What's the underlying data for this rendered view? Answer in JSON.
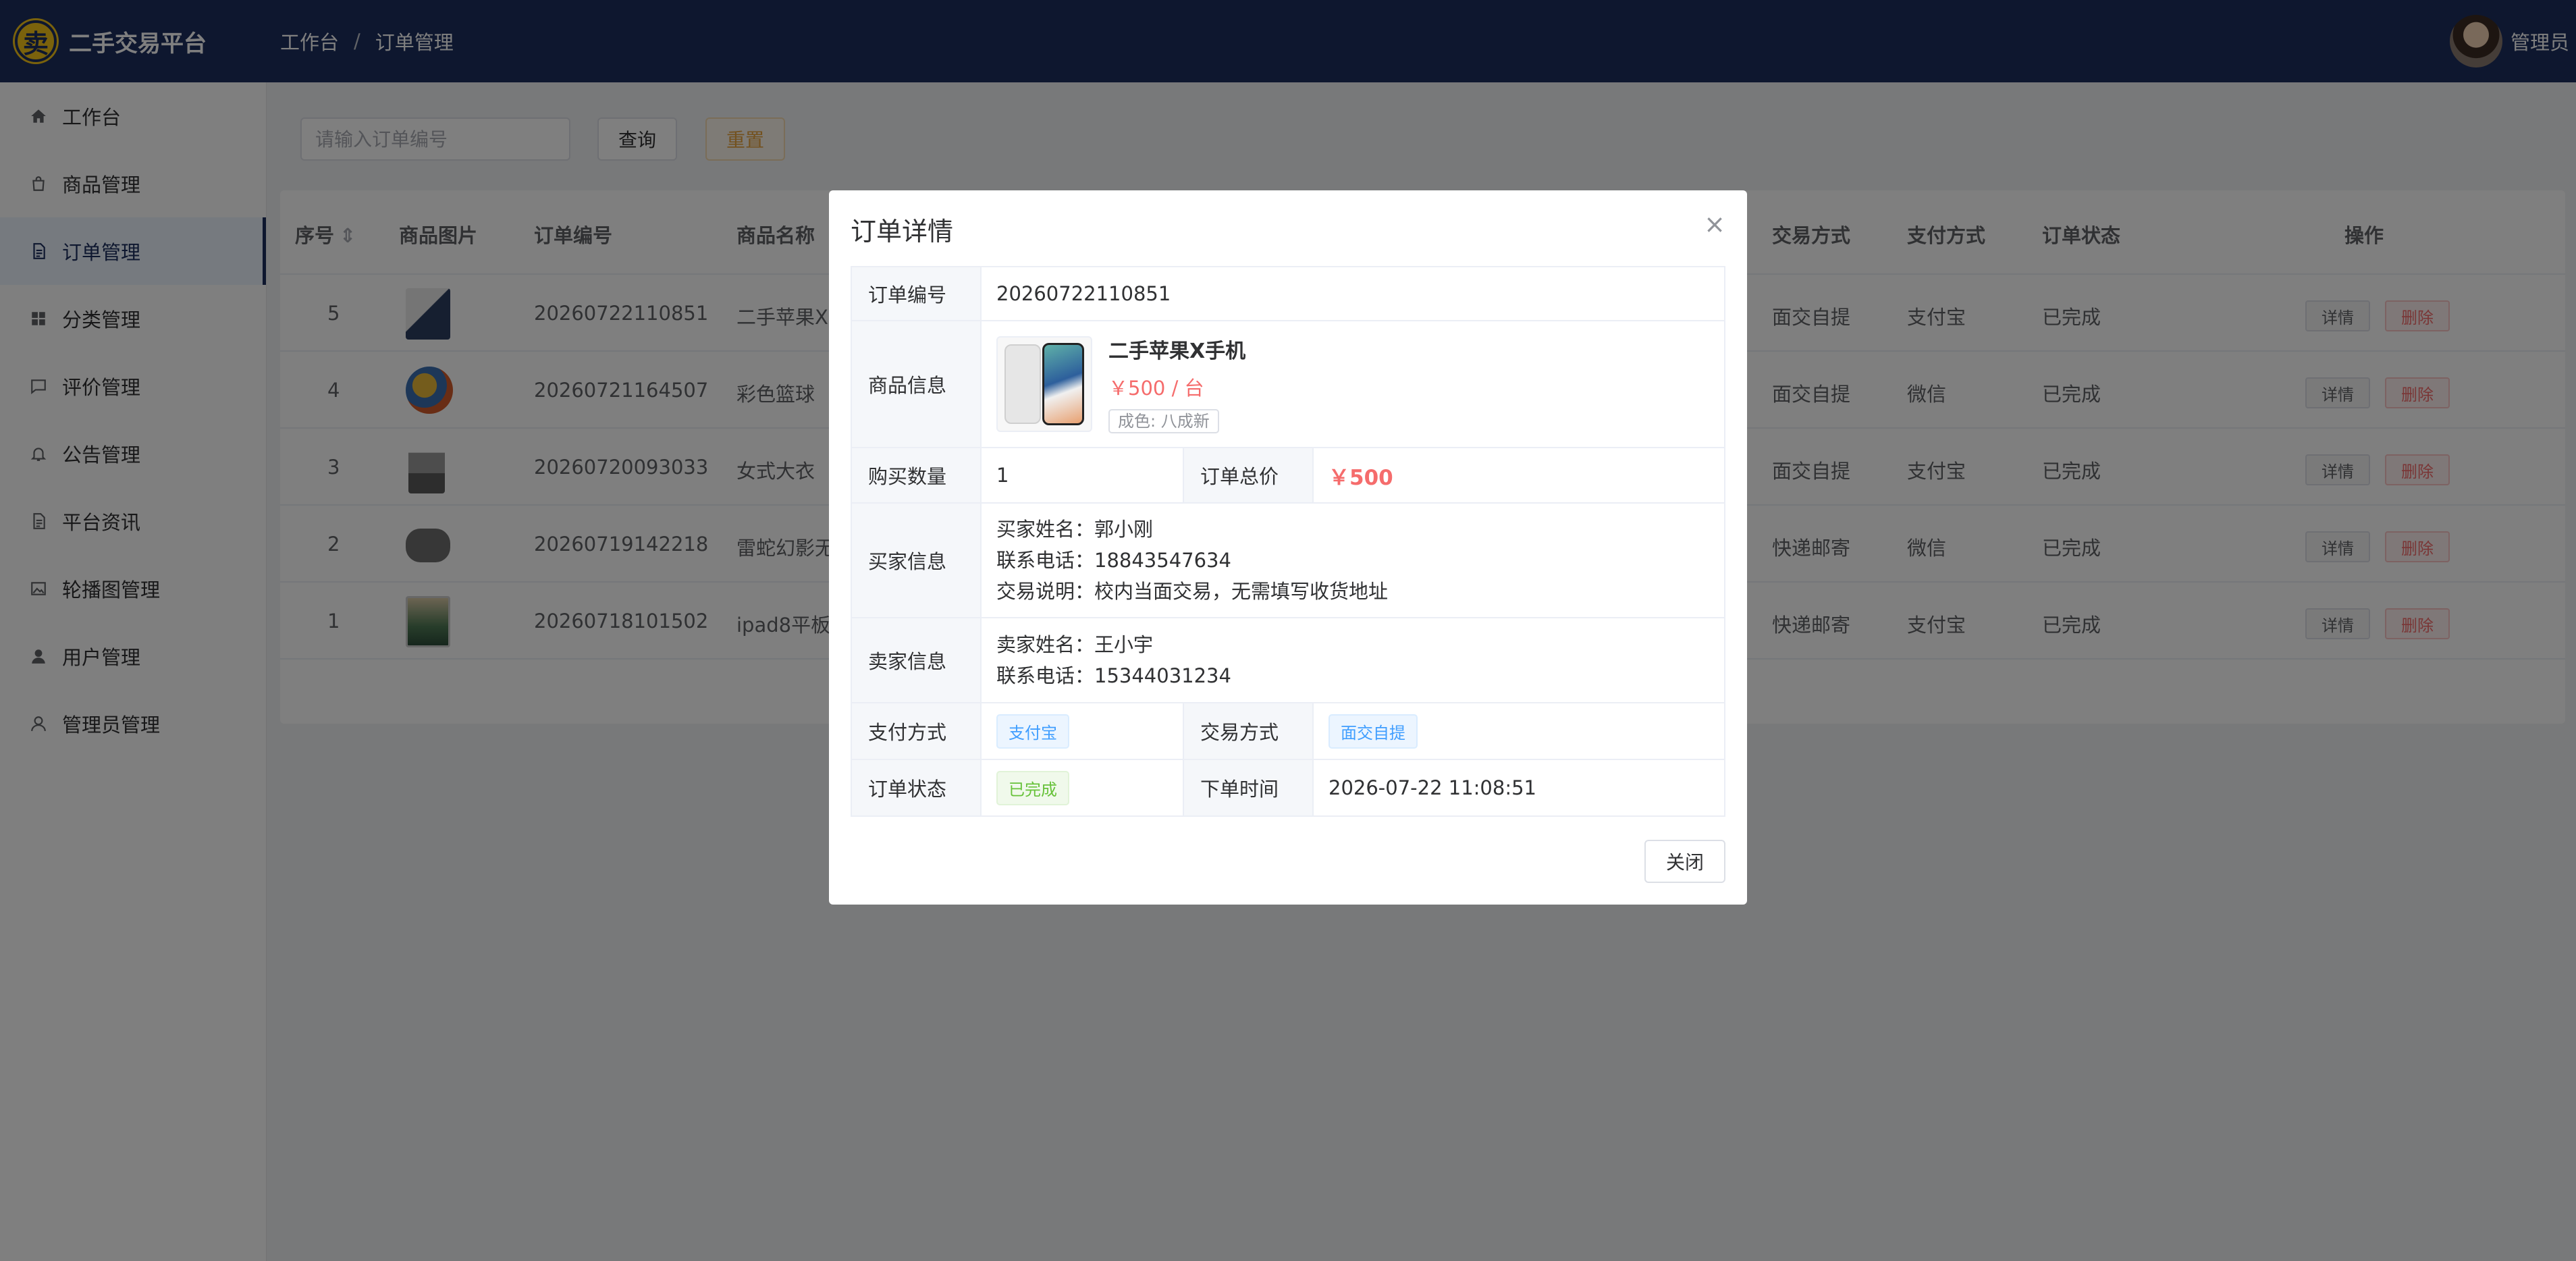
{
  "app": {
    "logo_char": "卖",
    "title": "二手交易平台"
  },
  "breadcrumb": {
    "home": "工作台",
    "separator": "/",
    "current": "订单管理"
  },
  "user": {
    "name": "管理员"
  },
  "sidebar": {
    "items": [
      {
        "label": "工作台",
        "icon": "home-icon"
      },
      {
        "label": "商品管理",
        "icon": "shopping-bag-icon"
      },
      {
        "label": "订单管理",
        "icon": "document-icon",
        "active": true
      },
      {
        "label": "分类管理",
        "icon": "grid-icon"
      },
      {
        "label": "评价管理",
        "icon": "chat-bubble-icon"
      },
      {
        "label": "公告管理",
        "icon": "bell-icon"
      },
      {
        "label": "平台资讯",
        "icon": "document-icon"
      },
      {
        "label": "轮播图管理",
        "icon": "picture-icon"
      },
      {
        "label": "用户管理",
        "icon": "user-filled-icon"
      },
      {
        "label": "管理员管理",
        "icon": "user-outline-icon"
      }
    ]
  },
  "search": {
    "placeholder": "请输入订单编号",
    "query_label": "查询",
    "reset_label": "重置"
  },
  "table": {
    "headers": {
      "index": "序号",
      "image": "商品图片",
      "order_no": "订单编号",
      "product": "商品名称",
      "trade_method": "交易方式",
      "pay_method": "支付方式",
      "status": "订单状态",
      "actions": "操作"
    },
    "rows": [
      {
        "index": "5",
        "order_no": "20260722110851",
        "product": "二手苹果X",
        "trade_method": "面交自提",
        "pay_method": "支付宝",
        "status": "已完成",
        "image": "phone"
      },
      {
        "index": "4",
        "order_no": "20260721164507",
        "product": "彩色篮球",
        "trade_method": "面交自提",
        "pay_method": "微信",
        "status": "已完成",
        "image": "ball"
      },
      {
        "index": "3",
        "order_no": "20260720093033",
        "product": "女式大衣",
        "trade_method": "面交自提",
        "pay_method": "支付宝",
        "status": "已完成",
        "image": "coat"
      },
      {
        "index": "2",
        "order_no": "20260719142218",
        "product": "雷蛇幻影无",
        "trade_method": "快递邮寄",
        "pay_method": "微信",
        "status": "已完成",
        "image": "gamepad"
      },
      {
        "index": "1",
        "order_no": "20260718101502",
        "product": "ipad8平板",
        "trade_method": "快递邮寄",
        "pay_method": "支付宝",
        "status": "已完成",
        "image": "tablet"
      }
    ],
    "detail_label": "详情",
    "delete_label": "删除"
  },
  "dialog": {
    "title": "订单详情",
    "labels": {
      "order_no": "订单编号",
      "product_info": "商品信息",
      "quantity": "购买数量",
      "total": "订单总价",
      "buyer_info": "买家信息",
      "seller_info": "卖家信息",
      "pay_method": "支付方式",
      "trade_method": "交易方式",
      "status": "订单状态",
      "order_time": "下单时间"
    },
    "order_no": "20260722110851",
    "product": {
      "name": "二手苹果X手机",
      "price": "￥500 / 台",
      "condition": "成色: 八成新"
    },
    "quantity": "1",
    "total": "￥500",
    "buyer": {
      "name": "买家姓名：郭小刚",
      "phone": "联系电话：18843547634",
      "note": "交易说明：校内当面交易，无需填写收货地址"
    },
    "seller": {
      "name": "卖家姓名：王小宇",
      "phone": "联系电话：15344031234"
    },
    "pay_method": "支付宝",
    "trade_method": "面交自提",
    "status": "已完成",
    "order_time": "2026-07-22 11:08:51",
    "close_label": "关闭",
    "close_icon": "×"
  },
  "colors": {
    "header_bg": "#1c2e5e",
    "accent_red": "#f56c6c",
    "logo_yellow": "#f5c518"
  }
}
